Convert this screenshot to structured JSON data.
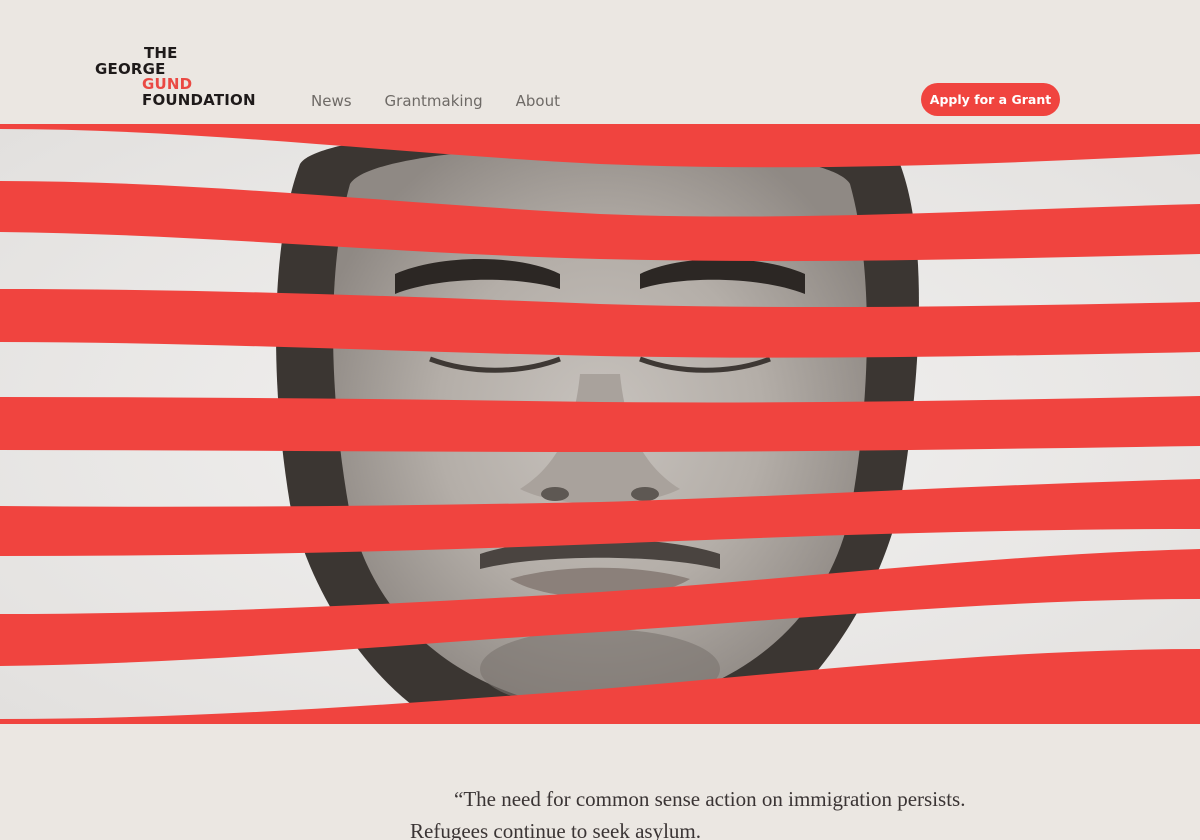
{
  "brand": {
    "logo_line1": "THE",
    "logo_line2": "GEORGE",
    "logo_line3": "GUND",
    "logo_line4": "FOUNDATION",
    "accent_color": "#f0443f",
    "ink_color": "#1e1a1a"
  },
  "nav": {
    "items": [
      {
        "label": "News"
      },
      {
        "label": "Grantmaking"
      },
      {
        "label": "About"
      }
    ]
  },
  "header": {
    "cta_label": "Apply for a Grant"
  },
  "hero": {
    "image_description_icon": "portrait-photo",
    "stripe_color": "#f0443f"
  },
  "quote": {
    "text": "“The need for common sense action on immigration persists. Refugees continue to seek asylum."
  }
}
